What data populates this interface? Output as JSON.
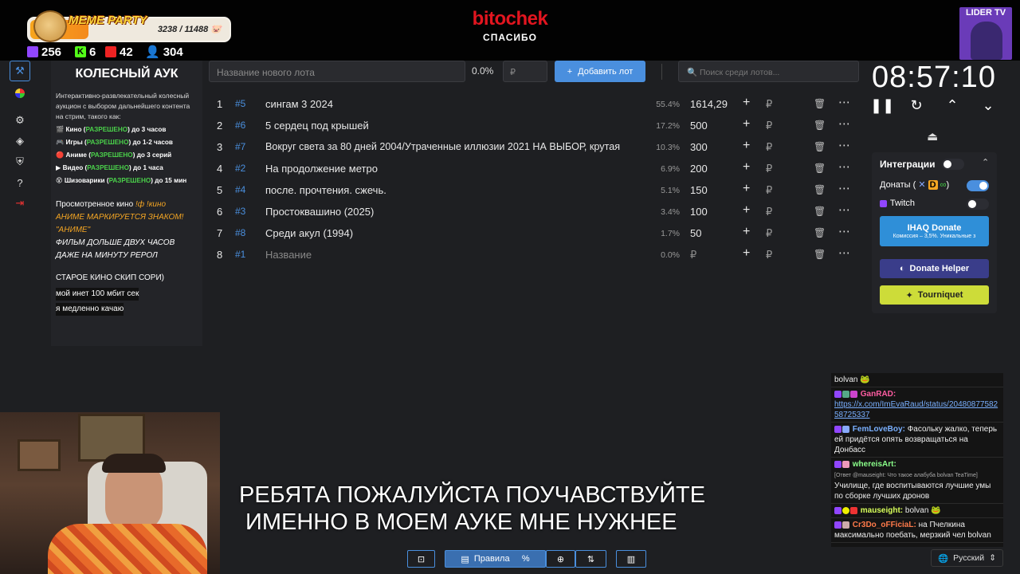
{
  "banner": {
    "title": "MEME PARTY",
    "count": "3238 / 11488"
  },
  "stats": {
    "twitch": "256",
    "kick": "6",
    "vk": "42",
    "viewers": "304"
  },
  "brand": {
    "name": "bitochek",
    "sub": "СПАСИБО"
  },
  "lider": {
    "title": "LIDER TV"
  },
  "info": {
    "title": "КОЛЕСНЫЙ АУК",
    "desc": "Интерактивно-развлекательный колесный аукцион с выбором дальнейшего контента на стрим, такого как:",
    "items": [
      {
        "pre": "Кино (",
        "ok": "РАЗРЕШЕНО",
        "post": ") до 3 часов"
      },
      {
        "pre": "Игры (",
        "ok": "РАЗРЕШЕНО",
        "post": ") до 1-2 часов"
      },
      {
        "pre": "Аниме (",
        "ok": "РАЗРЕШЕНО",
        "post": ") до 3 серий"
      },
      {
        "pre": "Видео (",
        "ok": "РАЗРЕШЕНО",
        "post": ") до 1 часа"
      },
      {
        "pre": "Шизоварики (",
        "ok": "РАЗРЕШЕНО",
        "post": ") до 15 мин"
      }
    ],
    "watched": "Просмотренное кино",
    "watched_link": "!ф !кино",
    "anime_note": "АНИМЕ МАРКИРУЕТСЯ ЗНАКОМ! \"АНИМЕ\"",
    "film_note": "ФИЛЬМ ДОЛЬШЕ ДВУХ ЧАСОВ ДАЖЕ НА МИНУТУ РЕРОЛ",
    "old_note": "СТАРОЕ КИНО СКИП СОРИ)",
    "net1": "мой инет 100 мбит сек",
    "net2": "я медленно качаю"
  },
  "controls": {
    "lot_placeholder": "Название нового лота",
    "pct": "0.0%",
    "rub_placeholder": "₽",
    "add_label": "Добавить лот",
    "search_placeholder": "Поиск среди лотов..."
  },
  "lots": [
    {
      "n": "1",
      "id": "#5",
      "name": "сингам 3 2024",
      "pct": "55.4%",
      "amount": "1614,29"
    },
    {
      "n": "2",
      "id": "#6",
      "name": "5 сердец под крышей",
      "pct": "17.2%",
      "amount": "500"
    },
    {
      "n": "3",
      "id": "#7",
      "name": "Вокруг света за 80 дней 2004/Утраченные иллюзии 2021 НА ВЫБОР, крутая",
      "pct": "10.3%",
      "amount": "300"
    },
    {
      "n": "4",
      "id": "#2",
      "name": "На продолжение метро",
      "pct": "6.9%",
      "amount": "200"
    },
    {
      "n": "5",
      "id": "#4",
      "name": "после. прочтения. сжечь.",
      "pct": "5.1%",
      "amount": "150"
    },
    {
      "n": "6",
      "id": "#3",
      "name": "Простоквашино (2025)",
      "pct": "3.4%",
      "amount": "100"
    },
    {
      "n": "7",
      "id": "#8",
      "name": "Среди акул (1994)",
      "pct": "1.7%",
      "amount": "50"
    },
    {
      "n": "8",
      "id": "#1",
      "name": "Название",
      "pct": "0.0%",
      "amount": "₽"
    }
  ],
  "timer": "08:57:10",
  "integrations": {
    "title": "Интеграции",
    "donations": "Донаты (",
    "twitch": "Twitch",
    "ihaq": "IHAQ Donate",
    "ihaq_sub": "Комиссия – 3,5%. Уникальные з",
    "donate_helper": "Donate Helper",
    "tourniquet": "Tourniquet"
  },
  "subtitle": {
    "line1": "РЕБЯТА ПОЖАЛУЙСТА ПОУЧАВСТВУЙТЕ",
    "line2": "ИМЕННО В МОЕМ АУКЕ МНЕ НУЖНЕЕ"
  },
  "chat": [
    {
      "user": "",
      "text": "bolvan"
    },
    {
      "user": "GanRAD:",
      "text": "https://x.com/ImEvaRaud/status/2048087758258725337"
    },
    {
      "user": "FemLoveBoy:",
      "text": "Фасольку жалко, теперь ей придётся опять возвращаться на Донбасс"
    },
    {
      "user": "whereisArt:",
      "reply": "[Ответ @mauseight: Что такое алабуба bolvan TeaTime]",
      "text": "Училище, где воспитываются лучшие умы по сборке лучших дронов"
    },
    {
      "user": "mauseight:",
      "text": "bolvan"
    },
    {
      "user": "Cr3Do_oFFiciaL:",
      "text": "на Пчелкина максимально поебать, мерзкий чел bolvan"
    }
  ],
  "bottom": {
    "rules": "Правила"
  },
  "lang": "Русский",
  "colors": {
    "accent": "#4a8fde",
    "brand": "#e2151f",
    "ok": "#4ad04a",
    "tourniquet": "#cddc39"
  }
}
